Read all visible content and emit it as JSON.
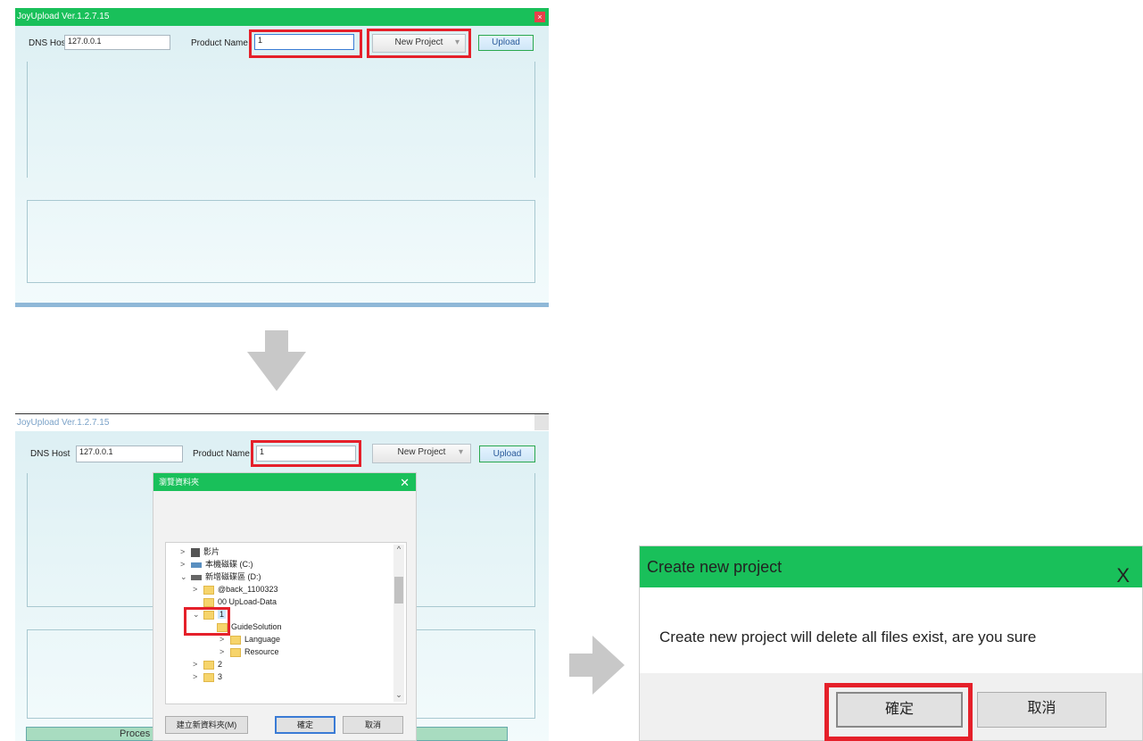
{
  "window_top": {
    "title": "JoyUpload  Ver.1.2.7.15",
    "close_glyph": "×",
    "dns_label": "DNS Host",
    "dns_value": "127.0.0.1",
    "product_label": "Product Name",
    "product_value": "1",
    "new_project_label": "New Project",
    "dropdown_glyph": "▾",
    "upload_label": "Upload"
  },
  "window_bottom": {
    "title": "JoyUpload  Ver.1.2.7.15",
    "dns_label": "DNS Host",
    "dns_value": "127.0.0.1",
    "product_label": "Product Name",
    "product_value": "1",
    "new_project_label": "New Project",
    "dropdown_glyph": "▾",
    "upload_label": "Upload",
    "process_label": "Proces"
  },
  "folder_dialog": {
    "title": "瀏覽資料夾",
    "close_glyph": "✕",
    "tree": [
      {
        "chevron": ">",
        "icon": "video-folder-icon",
        "label": "影片"
      },
      {
        "chevron": ">",
        "icon": "computer-drive-icon",
        "label": "本機磁碟 (C:)"
      },
      {
        "chevron": "⌄",
        "icon": "drive-icon",
        "label": "新增磁碟區 (D:)"
      },
      {
        "chevron": ">",
        "icon": "folder-icon",
        "label": "@back_1100323"
      },
      {
        "chevron": "",
        "icon": "folder-icon",
        "label": "00 UpLoad-Data"
      },
      {
        "chevron": "⌄",
        "icon": "folder-icon",
        "label": "1"
      },
      {
        "chevron": "",
        "icon": "folder-icon",
        "label": "GuideSolution"
      },
      {
        "chevron": ">",
        "icon": "folder-icon",
        "label": "Language"
      },
      {
        "chevron": ">",
        "icon": "folder-icon",
        "label": "Resource"
      },
      {
        "chevron": ">",
        "icon": "folder-icon",
        "label": "2"
      },
      {
        "chevron": ">",
        "icon": "folder-icon",
        "label": "3"
      }
    ],
    "scroll_up": "^",
    "scroll_down": "⌄",
    "new_folder_label": "建立新資料夾(M)",
    "ok_label": "確定",
    "cancel_label": "取消"
  },
  "confirm_dialog": {
    "title": "Create new project",
    "close_glyph": "X",
    "message": "Create new project will delete all files exist, are you sure",
    "ok_label": "確定",
    "cancel_label": "取消"
  },
  "colors": {
    "title_green": "#19c05a",
    "highlight_red": "#e5202a",
    "arrow_grey": "#c8c8c8"
  }
}
